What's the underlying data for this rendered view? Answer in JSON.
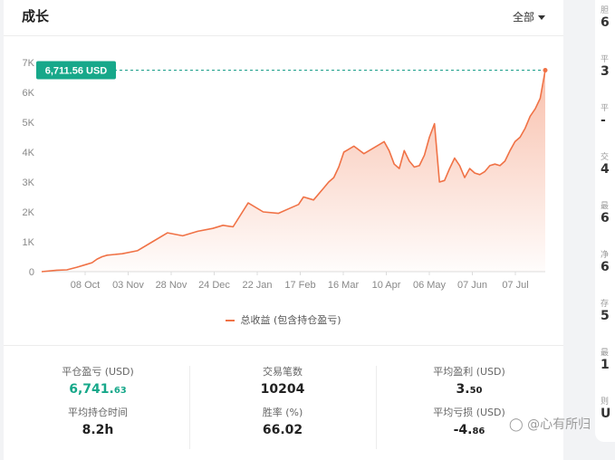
{
  "header": {
    "title": "成长",
    "filter_label": "全部"
  },
  "chart_data": {
    "type": "area",
    "x_labels": [
      "08 Oct",
      "03 Nov",
      "28 Nov",
      "24 Dec",
      "22 Jan",
      "17 Feb",
      "16 Mar",
      "10 Apr",
      "06 May",
      "07 Jun",
      "07 Jul"
    ],
    "y_labels": [
      "0",
      "1K",
      "2K",
      "3K",
      "4K",
      "5K",
      "6K",
      "7K"
    ],
    "ylim": [
      0,
      7000
    ],
    "series": [
      {
        "name": "总收益 (包含持仓盈亏)",
        "color": "#f07246",
        "x": [
          0,
          3,
          5,
          7,
          9,
          10,
          11,
          12,
          13,
          16,
          19,
          22,
          25,
          28,
          31,
          34,
          36,
          38,
          41,
          44,
          47,
          49,
          51,
          52,
          54,
          56,
          57,
          58,
          59,
          60,
          62,
          64,
          66,
          67,
          68,
          69,
          70,
          71,
          72,
          73,
          74,
          75,
          76,
          77,
          78,
          79,
          80,
          81,
          82,
          83,
          84,
          85,
          86,
          87,
          88,
          89,
          90,
          91,
          92,
          93,
          94,
          95,
          96,
          97,
          98,
          99,
          100
        ],
        "values": [
          0,
          50,
          60,
          150,
          250,
          300,
          420,
          500,
          550,
          600,
          700,
          1000,
          1300,
          1200,
          1350,
          1450,
          1550,
          1500,
          2300,
          2000,
          1950,
          2100,
          2250,
          2500,
          2400,
          2800,
          3000,
          3150,
          3500,
          4000,
          4200,
          3950,
          4150,
          4250,
          4350,
          4050,
          3600,
          3450,
          4050,
          3700,
          3500,
          3550,
          3900,
          4500,
          4950,
          3000,
          3050,
          3450,
          3800,
          3550,
          3150,
          3450,
          3300,
          3250,
          3350,
          3550,
          3600,
          3550,
          3700,
          4050,
          4350,
          4500,
          4800,
          5200,
          5450,
          5800,
          6741
        ]
      }
    ],
    "tooltip": "6,711.56 USD",
    "x_axis_note": "x values are the chart's relative time position (0–100) between the first and last date"
  },
  "legend": {
    "label": "总收益 (包含持仓盈亏)"
  },
  "stats": {
    "closed_pnl": {
      "label": "平仓盈亏 (USD)",
      "int": "6,741.",
      "dec": "63"
    },
    "trades": {
      "label": "交易笔数",
      "value": "10204"
    },
    "avg_profit": {
      "label": "平均盈利 (USD)",
      "int": "3.",
      "dec": "50"
    },
    "avg_hold": {
      "label": "平均持仓时间",
      "value": "8.2h"
    },
    "win_rate": {
      "label": "胜率 (%)",
      "value": "66.02"
    },
    "avg_loss": {
      "label": "平均亏损 (USD)",
      "int": "-4.",
      "dec": "86"
    }
  },
  "watermark": "心有所归",
  "right_panel": [
    {
      "label": "胆",
      "value": "6"
    },
    {
      "label": "平",
      "value": "3"
    },
    {
      "label": "平",
      "value": "-"
    },
    {
      "label": "交",
      "value": "4"
    },
    {
      "label": "最",
      "value": "6"
    },
    {
      "label": "净",
      "value": "6"
    },
    {
      "label": "存",
      "value": "5"
    },
    {
      "label": "最",
      "value": "1"
    },
    {
      "label": "则",
      "value": "U"
    }
  ]
}
